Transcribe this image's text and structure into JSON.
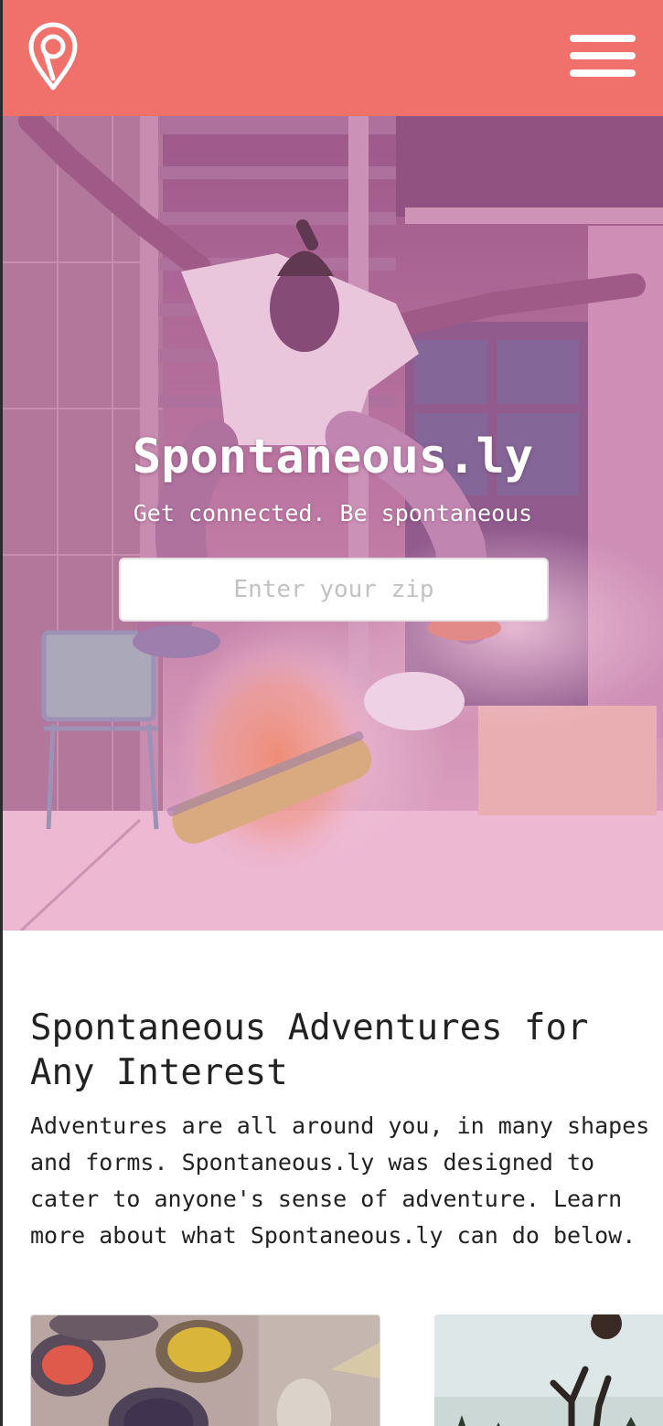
{
  "header": {
    "logo_icon": "map-pin-icon",
    "menu_icon": "hamburger-menu-icon",
    "background_color": "#f0706b"
  },
  "hero": {
    "title": "Spontaneous.ly",
    "tagline": "Get connected. Be spontaneous",
    "zip_input": {
      "placeholder": "Enter your zip",
      "value": ""
    },
    "overlay_color": "#e58bbf"
  },
  "main": {
    "heading": "Spontaneous Adventures for Any Interest",
    "body": "Adventures are all around you, in many shapes and forms. Spontaneous.ly was designed to cater to anyone's sense of adventure. Learn more about what Spontaneous.ly can do below."
  }
}
